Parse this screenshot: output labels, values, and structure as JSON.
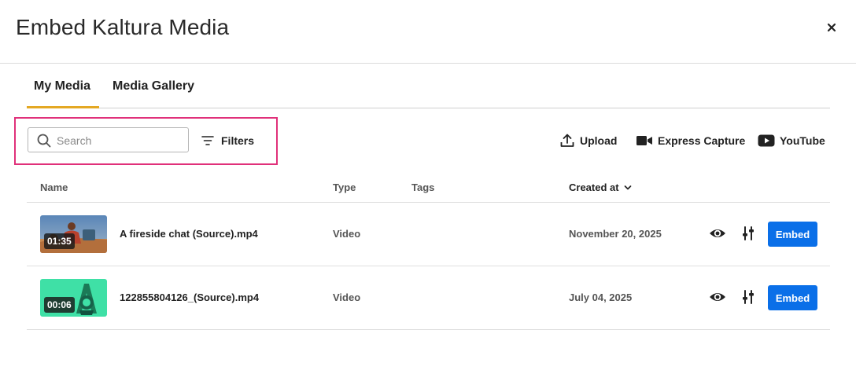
{
  "dialog": {
    "title": "Embed Kaltura Media",
    "close_icon": "close-icon"
  },
  "tabs": [
    {
      "label": "My Media",
      "active": true
    },
    {
      "label": "Media Gallery",
      "active": false
    }
  ],
  "toolbar": {
    "search_placeholder": "Search",
    "search_value": "",
    "filters_label": "Filters",
    "upload_label": "Upload",
    "express_capture_label": "Express Capture",
    "youtube_label": "YouTube"
  },
  "table": {
    "columns": {
      "name": "Name",
      "type": "Type",
      "tags": "Tags",
      "created": "Created at"
    },
    "sort": {
      "column": "created",
      "direction": "desc"
    },
    "rows": [
      {
        "name": "A fireside chat (Source).mp4",
        "duration": "01:35",
        "type": "Video",
        "tags": "",
        "created": "November 20, 2025",
        "embed_label": "Embed"
      },
      {
        "name": "122855804126_(Source).mp4",
        "duration": "00:06",
        "type": "Video",
        "tags": "",
        "created": "July 04, 2025",
        "embed_label": "Embed"
      }
    ]
  },
  "colors": {
    "accent_tab": "#e4a823",
    "highlight_box": "#e0307a",
    "embed_button": "#0a6fe8"
  }
}
